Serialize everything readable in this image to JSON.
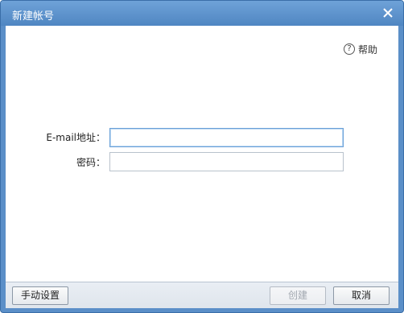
{
  "window": {
    "title": "新建帐号"
  },
  "help": {
    "label": "帮助",
    "icon": "question-circle-icon"
  },
  "form": {
    "email_label": "E-mail地址：",
    "email_value": "",
    "password_label": "密码：",
    "password_value": ""
  },
  "footer": {
    "manual_label": "手动设置",
    "create_label": "创建",
    "cancel_label": "取消"
  }
}
